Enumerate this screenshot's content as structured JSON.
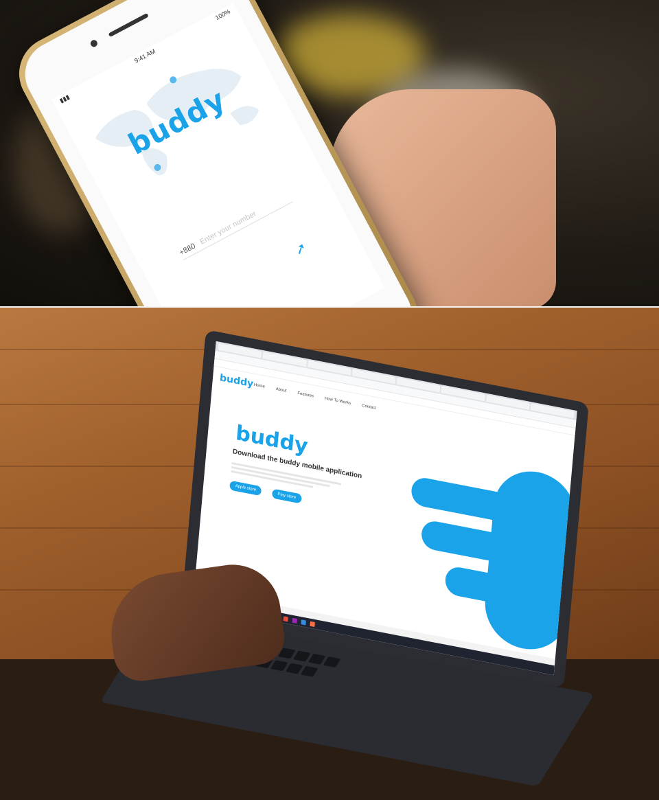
{
  "phone": {
    "status_time": "9:41 AM",
    "status_battery": "100%",
    "brand": "buddy",
    "country_code": "+880",
    "number_placeholder": "Enter your number",
    "next_icon": "arrow-right-icon"
  },
  "laptop": {
    "site_logo": "buddy",
    "hero_logo": "buddy",
    "hero_title": "Download the buddy mobile application",
    "nav_items": [
      "Home",
      "About",
      "Features",
      "How To Works",
      "Contact"
    ],
    "store_buttons": [
      "Apple store",
      "Play store"
    ],
    "colors": {
      "accent": "#1aa3e8"
    }
  }
}
